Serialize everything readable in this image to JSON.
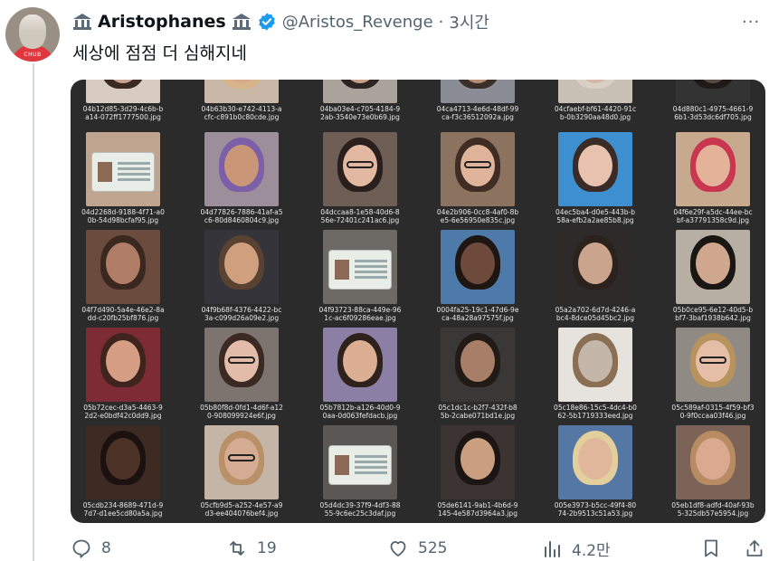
{
  "post": {
    "display_name": "Aristophanes",
    "handle": "@Aristos_Revenge",
    "separator": "·",
    "timestamp": "3시간",
    "text": "세상에 점점 더 심해지네",
    "more_label": "···"
  },
  "avatar": {
    "shirt_text": "CHUB"
  },
  "media": {
    "rows": [
      [
        {
          "caption": "04b12d85-3d29-4c6b-ba14-072ff1777500.jpg",
          "kind": "face",
          "skin": "#c9a38f",
          "hair": "#3a2a20",
          "bg": "#d8cbc0"
        },
        {
          "caption": "04b63b30-e742-4113-acfc-c891b0c80cde.jpg",
          "kind": "face",
          "skin": "#d9a98e",
          "hair": "#d7b48a",
          "bg": "#c9b7a7"
        },
        {
          "caption": "04ba03e4-c705-4184-92ab-3540e73e0b69.jpg",
          "kind": "face",
          "skin": "#caa08a",
          "hair": "#2d2522",
          "bg": "#aaa39c"
        },
        {
          "caption": "04ca4713-4e6d-48df-99ca-f3c36512092a.jpg",
          "kind": "face",
          "skin": "#b78c76",
          "hair": "#3b2f2a",
          "bg": "#8a8d95"
        },
        {
          "caption": "04cfaebf-bf61-4420-91cb-0b3290aa48d0.jpg",
          "kind": "face",
          "skin": "#d4b8a6",
          "hair": "#d9cfc4",
          "bg": "#c8bfb5"
        },
        {
          "caption": "04d880c1-4975-4661-96b1-3d53dc6df705.jpg",
          "kind": "face",
          "skin": "#5a4a42",
          "hair": "#1f1a18",
          "bg": "#333"
        }
      ],
      [
        {
          "caption": "04d2268d-9188-4f71-a00b-54d98bcfaf95.jpg",
          "kind": "card",
          "bg": "#bfa58f"
        },
        {
          "caption": "04d77826-7886-41af-a5c6-80d8460804c9.jpg",
          "kind": "face",
          "skin": "#c99777",
          "hair": "#7b5fa8",
          "bg": "#9d8e9c"
        },
        {
          "caption": "04dccaa8-1e58-40d6-856e-72401c241ac6.jpg",
          "kind": "face-glasses",
          "skin": "#e2b8a3",
          "hair": "#2a1f1c",
          "bg": "#6f5e56"
        },
        {
          "caption": "04e2b906-0cc8-4af0-8be5-6e56950e835c.jpg",
          "kind": "face-glasses",
          "skin": "#e0b49a",
          "hair": "#3e2c25",
          "bg": "#8b735f"
        },
        {
          "caption": "04ec5ba4-d0e5-443b-b58a-efb2a2ae85b8.jpg",
          "kind": "face",
          "skin": "#e8c2ae",
          "hair": "#3b2b26",
          "bg": "#3d8fcf"
        },
        {
          "caption": "04f6e29f-a5dc-44ee-bcbf-a37791358c9d.jpg",
          "kind": "face",
          "skin": "#e3b298",
          "hair": "#c8364f",
          "bg": "#c7a98e"
        }
      ],
      [
        {
          "caption": "04f7d490-5a4e-46e2-8add-c20fb25bf876.jpg",
          "kind": "face",
          "skin": "#b07d66",
          "hair": "#3a2720",
          "bg": "#6a4b3d"
        },
        {
          "caption": "04f9b68f-4376-4422-bc3a-c099d26a09e2.jpg",
          "kind": "face",
          "skin": "#d0a07e",
          "hair": "#5a4232",
          "bg": "#35343a"
        },
        {
          "caption": "04f93723-88ca-449e-961c-ac6f09286eae.jpg",
          "kind": "card",
          "bg": "#6d6a66"
        },
        {
          "caption": "0004fa25-19c1-47d6-9eca-48a28a97575f.jpg",
          "kind": "face",
          "skin": "#6d4a3b",
          "hair": "#1e1613",
          "bg": "#4d7aa8"
        },
        {
          "caption": "05a2a702-6d7d-4246-abc4-8dce05d45bc2.jpg",
          "kind": "face",
          "skin": "#caa48d",
          "hair": "#2b211d",
          "bg": "#2e2a29"
        },
        {
          "caption": "05b0ce95-6e12-40d5-bbf7-3baf1938b642.jpg",
          "kind": "face",
          "skin": "#cfa78e",
          "hair": "#1a1614",
          "bg": "#b7aea4"
        }
      ],
      [
        {
          "caption": "05b72cec-d3a5-4463-92d2-e0bdf42c0dd9.jpg",
          "kind": "face",
          "skin": "#d59d84",
          "hair": "#3e241d",
          "bg": "#7d2b35"
        },
        {
          "caption": "05b80f8d-0fd1-4d6f-a120-908099924e6f.jpg",
          "kind": "face-glasses",
          "skin": "#e2bca9",
          "hair": "#3a2a23",
          "bg": "#7d7470"
        },
        {
          "caption": "05b7812b-a126-40d0-90aa-0d063fefdacb.jpg",
          "kind": "face",
          "skin": "#dcae94",
          "hair": "#2f221d",
          "bg": "#8c7fa5"
        },
        {
          "caption": "05c1dc1c-b2f7-432f-b85b-2cabe071bd1e.jpg",
          "kind": "face",
          "skin": "#a77e68",
          "hair": "#221a16",
          "bg": "#3a3836"
        },
        {
          "caption": "05c18e86-15c5-4dc4-b062-5b1719333eed.jpg",
          "kind": "face",
          "skin": "#c4b7a9",
          "hair": "#8b6f55",
          "bg": "#e6e3df"
        },
        {
          "caption": "05c589af-0315-4f59-bf30-9f0ccaa03f46.jpg",
          "kind": "face-glasses",
          "skin": "#e4bea6",
          "hair": "#b8935d",
          "bg": "#8f8a84"
        }
      ],
      [
        {
          "caption": "05cdb234-8689-471d-97d7-d1ee5cd80a5a.jpg",
          "kind": "face",
          "skin": "#4c3127",
          "hair": "#1b1210",
          "bg": "#3d2a22"
        },
        {
          "caption": "05cfb9d5-a252-4e57-a9d3-ee404076bef4.jpg",
          "kind": "face-glasses",
          "skin": "#d6ab93",
          "hair": "#b99067",
          "bg": "#c5b5a7"
        },
        {
          "caption": "05d4dc39-37f9-4df3-8855-9c6ec25c3daf.jpg",
          "kind": "card",
          "bg": "#5a5754"
        },
        {
          "caption": "05de6141-9ab1-4b6d-9145-4e587d3964a3.jpg",
          "kind": "face",
          "skin": "#c99f80",
          "hair": "#1b1613",
          "bg": "#3b3432"
        },
        {
          "caption": "005e3973-b5cc-49f4-8074-2b9513c51a53.jpg",
          "kind": "face",
          "skin": "#e0b79a",
          "hair": "#e3cf9b",
          "bg": "#5577a3"
        },
        {
          "caption": "05eb1df8-adfd-40af-93b5-325db57e5954.jpg",
          "kind": "face",
          "skin": "#dba98f",
          "hair": "#b88b63",
          "bg": "#7b6457"
        }
      ]
    ]
  },
  "actions": {
    "reply_count": "8",
    "retweet_count": "19",
    "like_count": "525",
    "views_count": "4.2만"
  },
  "colors": {
    "verified": "#1d9bf0",
    "icon_gray": "#536471",
    "media_bg": "#2b2b2b"
  }
}
